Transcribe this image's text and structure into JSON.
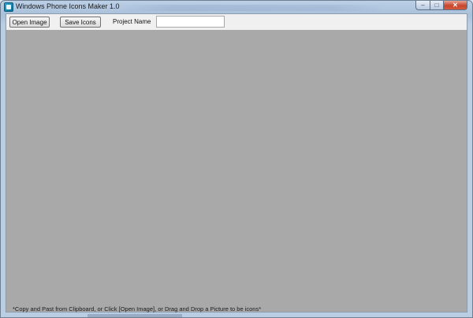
{
  "window": {
    "title": "Windows Phone Icons Maker 1.0",
    "minimize_glyph": "–",
    "maximize_glyph": "□",
    "close_glyph": "✕",
    "icon": "app-icon"
  },
  "toolbar": {
    "open_label": "Open Image",
    "save_label": "Save Icons",
    "project_label": "Project Name",
    "project_value": "",
    "project_placeholder": ""
  },
  "canvas": {
    "hint": "*Copy and Past from Clipboard, or Click [Open Image], or Drag and Drop a Picture to be icons*"
  },
  "colors": {
    "canvas_bg": "#a9a9a9",
    "close_button": "#c7462d",
    "frame": "#b9cde3"
  }
}
